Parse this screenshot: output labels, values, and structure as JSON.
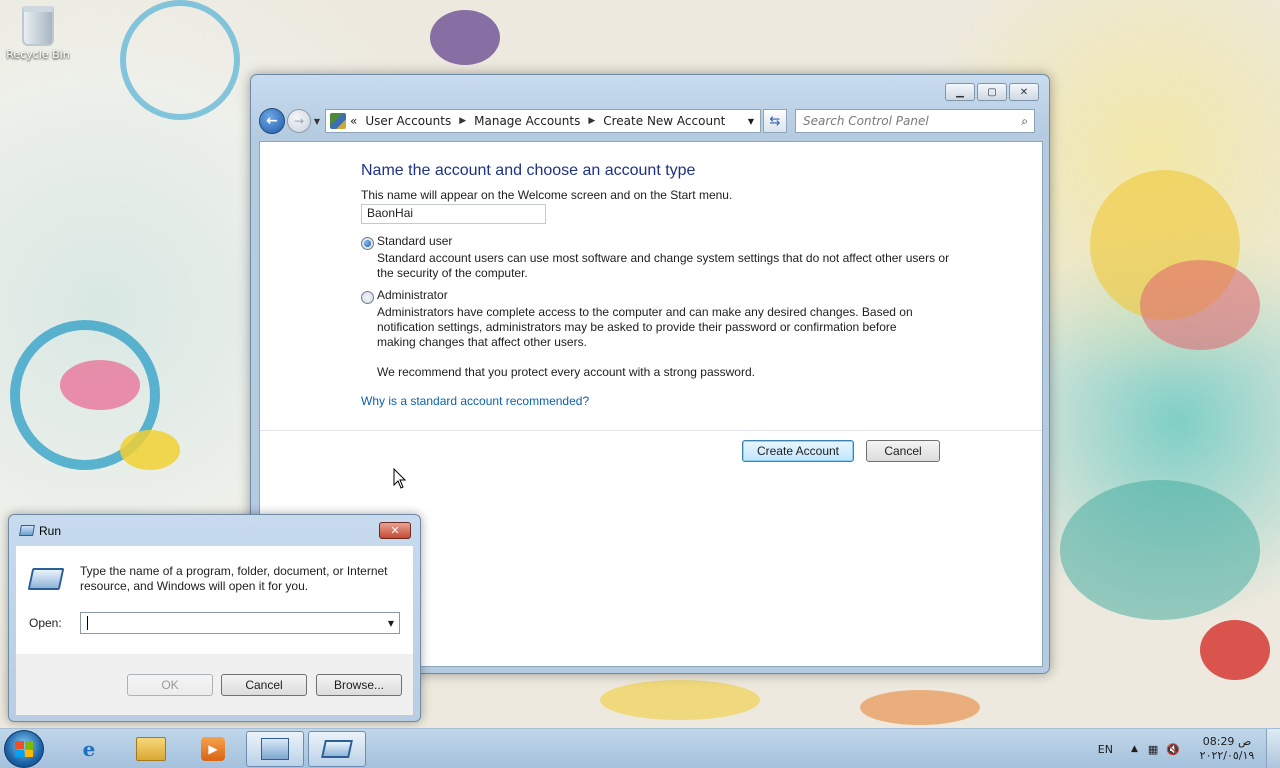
{
  "desktop": {
    "recycle_bin_label": "Recycle Bin"
  },
  "window": {
    "breadcrumb_prefix": "«",
    "breadcrumb": [
      "User Accounts",
      "Manage Accounts",
      "Create New Account"
    ],
    "search_placeholder": "Search Control Panel",
    "icons": {
      "back": "back-arrow-icon",
      "forward": "forward-arrow-icon",
      "refresh": "refresh-icon",
      "search": "search-icon"
    }
  },
  "create_account": {
    "heading": "Name the account and choose an account type",
    "name_hint": "This name will appear on the Welcome screen and on the Start menu.",
    "name_value": "BaonHai",
    "standard_label": "Standard user",
    "standard_desc_1": "Standard account users can use most software and change system settings that do not affect other users or",
    "standard_desc_2": "the security of the computer.",
    "standard_selected": true,
    "admin_label": "Administrator",
    "admin_desc_1": "Administrators have complete access to the computer and can make any desired changes. Based on",
    "admin_desc_2": "notification settings, administrators may be asked to provide their password or confirmation before",
    "admin_desc_3": "making changes that affect other users.",
    "recommend": "We recommend that you protect every account with a strong password.",
    "why_link": "Why is a standard account recommended?",
    "create_button": "Create Account",
    "cancel_button": "Cancel"
  },
  "run_dialog": {
    "title": "Run",
    "close_glyph": "✕",
    "description_1": "Type the name of a program, folder, document, or Internet",
    "description_2": "resource, and Windows will open it for you.",
    "open_label": "Open:",
    "open_value": "",
    "ok_button": "OK",
    "cancel_button": "Cancel",
    "browse_button": "Browse..."
  },
  "taskbar": {
    "language": "EN",
    "time": "08:29 ص",
    "date": "٢٠٢٢/٠٥/١٩",
    "items": [
      "internet-explorer-icon",
      "file-explorer-icon",
      "media-player-icon",
      "control-panel-icon",
      "run-icon"
    ]
  },
  "colors": {
    "heading": "#1e3287",
    "link": "#0b62b0",
    "taskbar": "#a6bdd6"
  }
}
